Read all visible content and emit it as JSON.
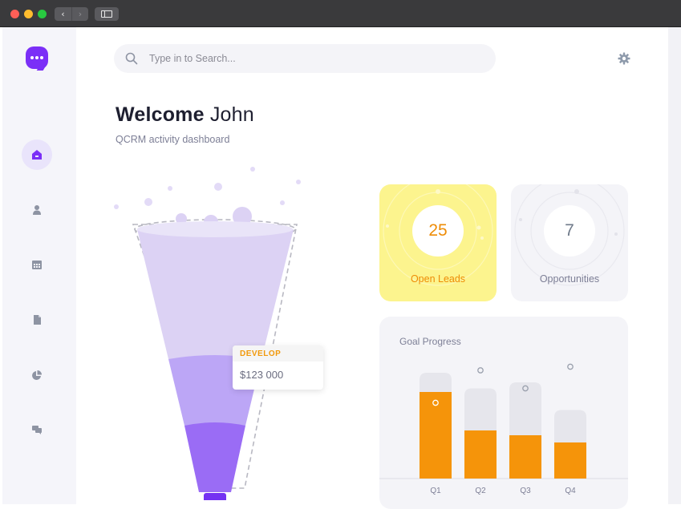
{
  "window": {
    "nav_back": "‹",
    "nav_forward": "›"
  },
  "search": {
    "placeholder": "Type in to Search..."
  },
  "header": {
    "welcome_bold": "Welcome",
    "welcome_name": "John",
    "subtitle": "QCRM activity dashboard"
  },
  "sidebar": {
    "items": [
      {
        "icon": "home-icon",
        "active": true
      },
      {
        "icon": "user-icon",
        "active": false
      },
      {
        "icon": "calendar-icon",
        "active": false
      },
      {
        "icon": "document-icon",
        "active": false
      },
      {
        "icon": "pie-chart-icon",
        "active": false
      },
      {
        "icon": "chat-icon",
        "active": false
      }
    ]
  },
  "funnel": {
    "tooltip_stage": "DEVELOP",
    "tooltip_value": "$123 000"
  },
  "cards": {
    "leads": {
      "value": "25",
      "label": "Open Leads"
    },
    "opportunities": {
      "value": "7",
      "label": "Opportunities"
    }
  },
  "colors": {
    "brand": "#7b2ff7",
    "accent_orange": "#f5940a",
    "leads_bg": "#fcf48e"
  },
  "chart_data": {
    "type": "bar",
    "title": "Goal Progress",
    "categories": [
      "Q1",
      "Q2",
      "Q3",
      "Q4"
    ],
    "series": [
      {
        "values": [
          0.72,
          0.4,
          0.36,
          0.3
        ]
      },
      {
        "values": [
          0.88,
          0.75,
          0.8,
          0.57
        ]
      }
    ],
    "markers": [
      0.63,
      0.9,
      0.75,
      0.93
    ],
    "ylim": [
      0,
      1
    ]
  }
}
